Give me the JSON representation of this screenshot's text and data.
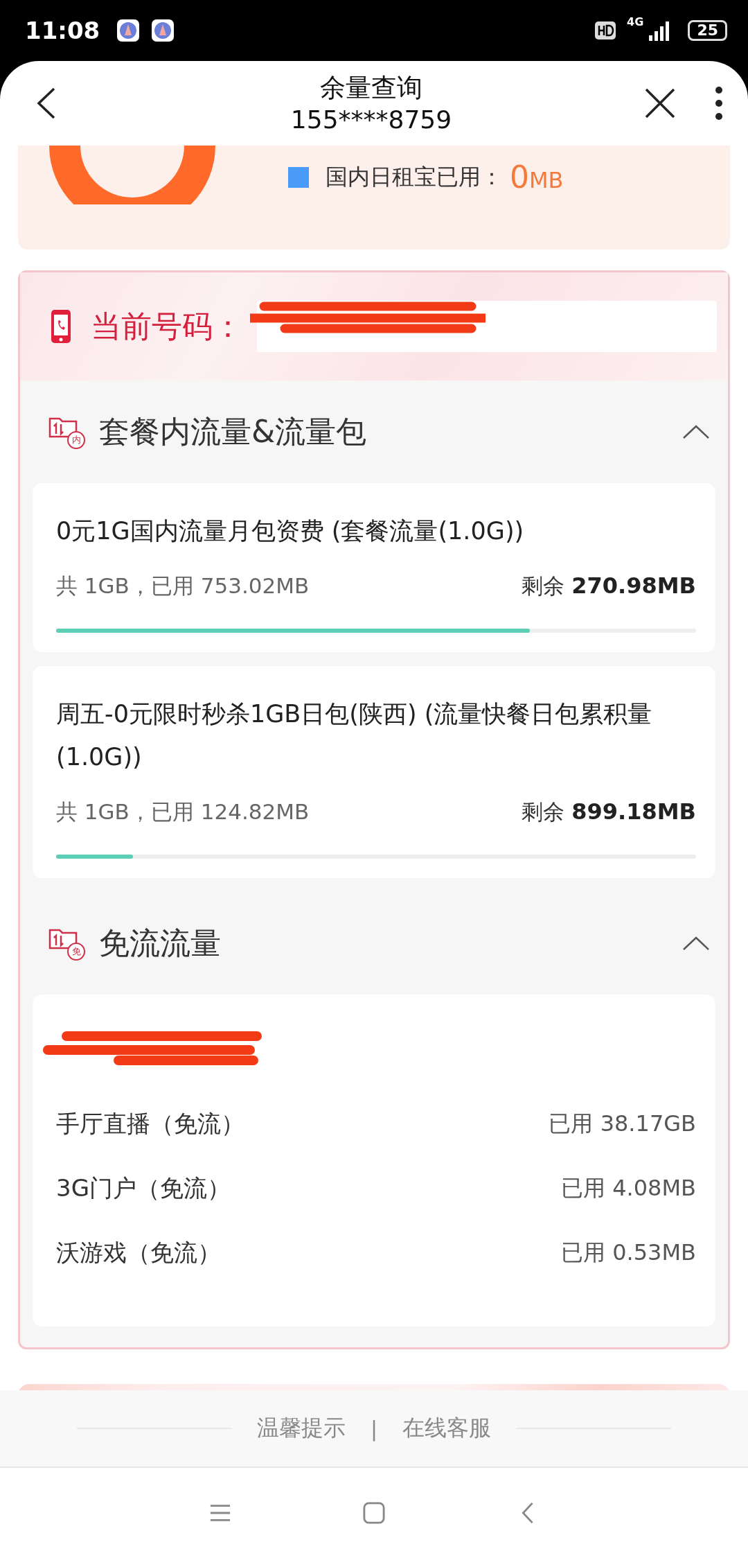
{
  "status_bar": {
    "time": "11:08",
    "network": "4G",
    "battery": "25"
  },
  "header": {
    "title": "余量查询",
    "subtitle": "155****8759"
  },
  "usage_summary": {
    "legend": [
      {
        "label": "国内日租宝已用：",
        "value": "0",
        "unit": "MB",
        "color": "#4a9bf7"
      }
    ]
  },
  "current_number": {
    "label": "当前号码："
  },
  "sections": [
    {
      "title": "套餐内流量&流量包",
      "badge": "内",
      "expanded": true,
      "kind": "packages",
      "items": [
        {
          "name": "0元1G国内流量月包资费 (套餐流量(1.0G))",
          "used_text": "共 1GB，已用 753.02MB",
          "remain_label": "剩余",
          "remain_value": "270.98MB",
          "level": 0.74
        },
        {
          "name": "周五-0元限时秒杀1GB日包(陕西) (流量快餐日包累积量(1.0G))",
          "used_text": "共 1GB，已用 124.82MB",
          "remain_label": "剩余",
          "remain_value": "899.18MB",
          "level": 0.12
        }
      ]
    },
    {
      "title": "免流流量",
      "badge": "免",
      "expanded": true,
      "kind": "free",
      "items": [
        {
          "name": "手厅直播（免流）",
          "used_text": "已用 38.17GB"
        },
        {
          "name": "3G门户（免流）",
          "used_text": "已用 4.08MB"
        },
        {
          "name": "沃游戏（免流）",
          "used_text": "已用 0.53MB"
        }
      ]
    }
  ],
  "footer_links": [
    "温馨提示",
    "在线客服"
  ],
  "footer_separator": "|"
}
